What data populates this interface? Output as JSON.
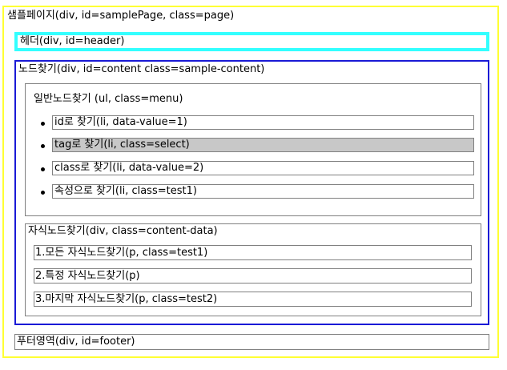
{
  "page": {
    "label": "샘플페이지(div, id=samplePage, class=page)"
  },
  "header": {
    "label": "헤더(div, id=header)"
  },
  "content": {
    "label": "노드찾기(div, id=content class=sample-content)",
    "menu": {
      "label": "일반노드찾기 (ul, class=menu)",
      "items": [
        {
          "label": "id로 찾기(li, data-value=1)",
          "selected": false
        },
        {
          "label": "tag로 찾기(li, class=select)",
          "selected": true
        },
        {
          "label": "class로 찾기(li, data-value=2)",
          "selected": false
        },
        {
          "label": "속성으로 찾기(li, class=test1)",
          "selected": false
        }
      ]
    },
    "content_data": {
      "label": "자식노드찾기(div, class=content-data)",
      "paragraphs": [
        "1.모든 자식노드찾기(p, class=test1)",
        "2.특정 자식노드찾기(p)",
        "3.마지막 자식노드찾기(p, class=test2)"
      ]
    }
  },
  "footer": {
    "label": "푸터영역(div, id=footer)"
  },
  "colors": {
    "page_border": "#ffff33",
    "header_border": "#33ffff",
    "content_border": "#1a1ad6",
    "box_border": "#808080",
    "selected_bg": "#c8c8c8"
  }
}
